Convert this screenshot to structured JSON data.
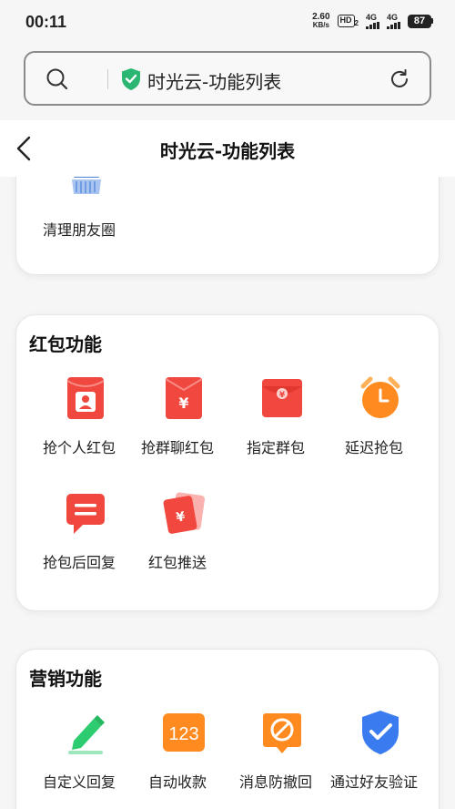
{
  "status_bar": {
    "time": "00:11",
    "net_speed_value": "2.60",
    "net_speed_unit": "KB/s",
    "hd": "HD",
    "hd_sub": "2",
    "signal1": "4G",
    "signal2": "4G",
    "battery": "87"
  },
  "browser": {
    "url_text": "时光云-功能列表"
  },
  "header": {
    "title": "时光云-功能列表"
  },
  "sections": [
    {
      "title": "",
      "items": [
        {
          "label": "清理朋友圈",
          "icon": "broom-icon"
        }
      ]
    },
    {
      "title": "红包功能",
      "items": [
        {
          "label": "抢个人红包",
          "icon": "red-envelope-person-icon"
        },
        {
          "label": "抢群聊红包",
          "icon": "red-envelope-yen-icon"
        },
        {
          "label": "指定群包",
          "icon": "red-envelope-group-icon"
        },
        {
          "label": "延迟抢包",
          "icon": "clock-icon"
        },
        {
          "label": "抢包后回复",
          "icon": "chat-bubble-icon"
        },
        {
          "label": "红包推送",
          "icon": "red-envelope-push-icon"
        }
      ]
    },
    {
      "title": "营销功能",
      "items": [
        {
          "label": "自定义回复",
          "icon": "pencil-icon"
        },
        {
          "label": "自动收款",
          "icon": "number-123-icon"
        },
        {
          "label": "消息防撤回",
          "icon": "anti-recall-icon"
        },
        {
          "label": "通过好友验证",
          "icon": "shield-check-icon"
        }
      ]
    }
  ],
  "colors": {
    "red": "#f0473e",
    "orange": "#ff8a1f",
    "green": "#2ecc71",
    "blue": "#3a7bf0",
    "broom_blue": "#4a82d8"
  }
}
